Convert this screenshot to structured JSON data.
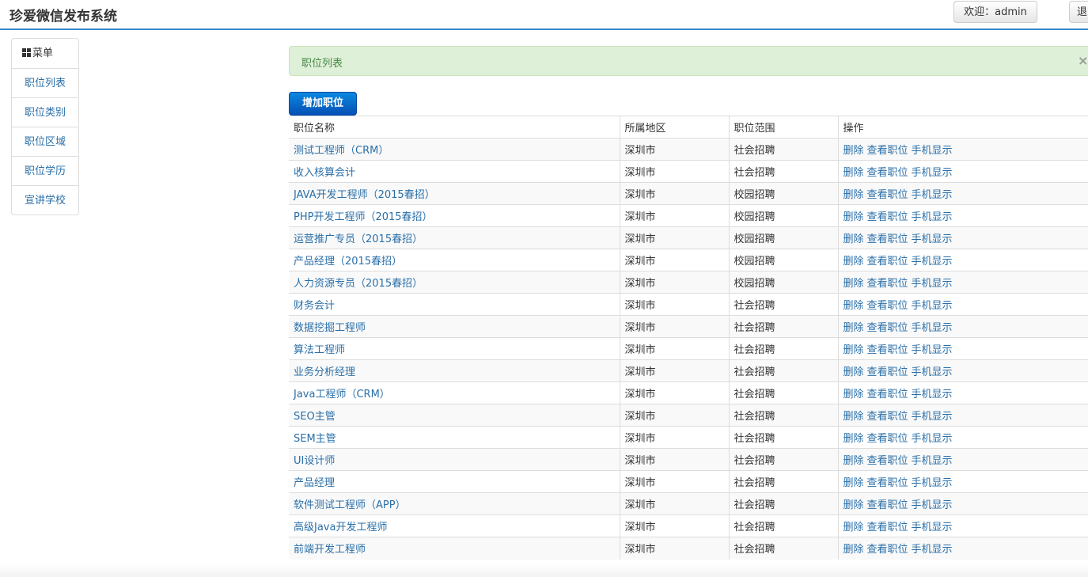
{
  "header": {
    "title": "珍爱微信发布系统",
    "welcome": "欢迎：admin",
    "logout": "退出"
  },
  "sidebar": {
    "header": "菜单",
    "header_icon": "grid-icon",
    "items": [
      {
        "label": "职位列表"
      },
      {
        "label": "职位类别"
      },
      {
        "label": "职位区域"
      },
      {
        "label": "职位学历"
      },
      {
        "label": "宣讲学校"
      }
    ]
  },
  "alert": {
    "text": "职位列表",
    "close": "×"
  },
  "add_button": "增加职位",
  "table": {
    "headers": [
      "职位名称",
      "所属地区",
      "职位范围",
      "操作"
    ],
    "actions": [
      "删除",
      "查看职位",
      "手机显示"
    ],
    "rows": [
      {
        "name": "测试工程师（CRM）",
        "region": "深圳市",
        "scope": "社会招聘"
      },
      {
        "name": "收入核算会计",
        "region": "深圳市",
        "scope": "社会招聘"
      },
      {
        "name": "JAVA开发工程师（2015春招）",
        "region": "深圳市",
        "scope": "校园招聘"
      },
      {
        "name": "PHP开发工程师（2015春招）",
        "region": "深圳市",
        "scope": "校园招聘"
      },
      {
        "name": "运营推广专员（2015春招）",
        "region": "深圳市",
        "scope": "校园招聘"
      },
      {
        "name": "产品经理（2015春招）",
        "region": "深圳市",
        "scope": "校园招聘"
      },
      {
        "name": "人力资源专员（2015春招）",
        "region": "深圳市",
        "scope": "校园招聘"
      },
      {
        "name": "财务会计",
        "region": "深圳市",
        "scope": "社会招聘"
      },
      {
        "name": "数据挖掘工程师",
        "region": "深圳市",
        "scope": "社会招聘"
      },
      {
        "name": "算法工程师",
        "region": "深圳市",
        "scope": "社会招聘"
      },
      {
        "name": "业务分析经理",
        "region": "深圳市",
        "scope": "社会招聘"
      },
      {
        "name": "Java工程师（CRM）",
        "region": "深圳市",
        "scope": "社会招聘"
      },
      {
        "name": "SEO主管",
        "region": "深圳市",
        "scope": "社会招聘"
      },
      {
        "name": "SEM主管",
        "region": "深圳市",
        "scope": "社会招聘"
      },
      {
        "name": "UI设计师",
        "region": "深圳市",
        "scope": "社会招聘"
      },
      {
        "name": "产品经理",
        "region": "深圳市",
        "scope": "社会招聘"
      },
      {
        "name": "软件测试工程师（APP）",
        "region": "深圳市",
        "scope": "社会招聘"
      },
      {
        "name": "高级Java开发工程师",
        "region": "深圳市",
        "scope": "社会招聘"
      },
      {
        "name": "前端开发工程师",
        "region": "深圳市",
        "scope": "社会招聘"
      }
    ]
  }
}
